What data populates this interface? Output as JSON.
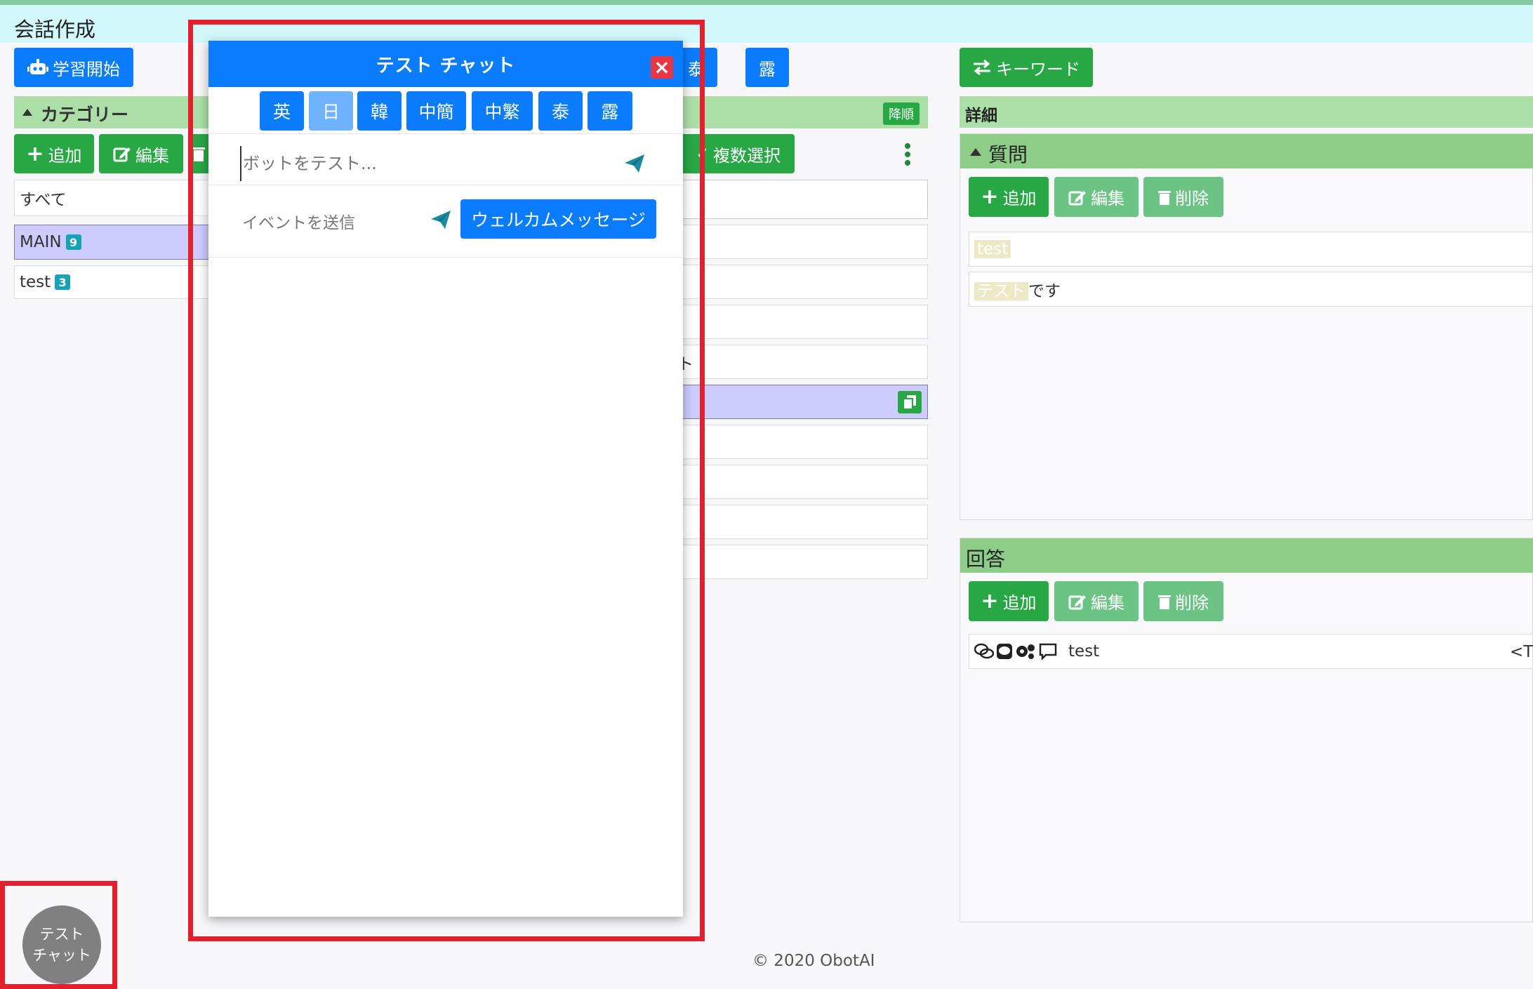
{
  "page": {
    "title": "会話作成"
  },
  "toolbar": {
    "learn_button": "学習開始",
    "lang_thai": "泰",
    "lang_russian": "露",
    "keyword_button": "キーワード"
  },
  "category": {
    "header": "カテゴリー",
    "add": "追加",
    "edit": "編集",
    "items": [
      {
        "label": "すべて",
        "count": ""
      },
      {
        "label": "MAIN",
        "count": "9"
      },
      {
        "label": "test",
        "count": "3"
      }
    ]
  },
  "conversations": {
    "sort_badge": "降順",
    "multi_select": "複数選択",
    "partial_text": "スト"
  },
  "detail": {
    "header": "詳細",
    "question": {
      "header": "質問",
      "add": "追加",
      "edit": "編集",
      "delete": "削除",
      "items": [
        {
          "highlight": "test",
          "rest": ""
        },
        {
          "highlight": "テスト",
          "rest": "です"
        }
      ]
    },
    "answer": {
      "header": "回答",
      "add": "追加",
      "edit": "編集",
      "delete": "削除",
      "items": [
        {
          "text": "test",
          "tail": "<TE"
        }
      ]
    }
  },
  "chat": {
    "title": "テスト チャット",
    "languages": [
      "英",
      "日",
      "韓",
      "中簡",
      "中繁",
      "泰",
      "露"
    ],
    "active_language": "日",
    "input_placeholder": "ボットをテスト...",
    "event_label": "イベントを送信",
    "welcome_button": "ウェルカムメッセージ"
  },
  "fab": {
    "line1": "テスト",
    "line2": "チャット"
  },
  "footer": {
    "text": "© 2020 ObotAI"
  },
  "colors": {
    "primary": "#0a7cff",
    "success": "#28a745",
    "success_light": "#6cc484",
    "danger": "#e53844",
    "selected": "#cdcbff",
    "header_bg": "#d2f8fc",
    "annotation_red": "#e5202e"
  }
}
